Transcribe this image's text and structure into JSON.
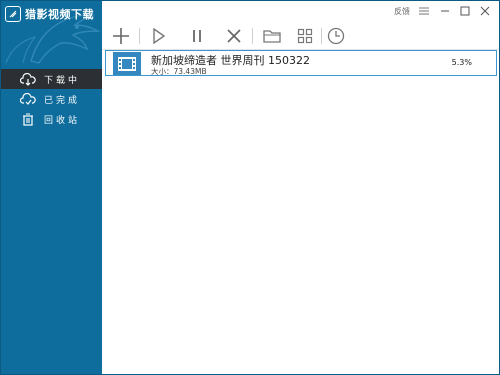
{
  "app": {
    "title": "猎影视频下载"
  },
  "titlebar": {
    "feedback": "反馈"
  },
  "sidebar": {
    "items": [
      {
        "label": "下载中",
        "icon": "cloud-download-icon",
        "active": true
      },
      {
        "label": "已完成",
        "icon": "cloud-done-icon",
        "active": false
      },
      {
        "label": "回收站",
        "icon": "trash-icon",
        "active": false
      }
    ]
  },
  "toolbar": {
    "icons": [
      "add-icon",
      "play-icon",
      "pause-icon",
      "delete-icon",
      "folder-icon",
      "grid-icon",
      "clock-icon"
    ]
  },
  "downloads": [
    {
      "title": "新加坡缔造者 世界周刊 150322",
      "size": "大小：73.43MB",
      "progress": "5.3%",
      "icon": "film-icon"
    }
  ],
  "colors": {
    "sidebar": "#0e6d9d",
    "active_nav": "#2c2f33",
    "row_border": "#3a97cf",
    "thumb": "#3587bf"
  }
}
